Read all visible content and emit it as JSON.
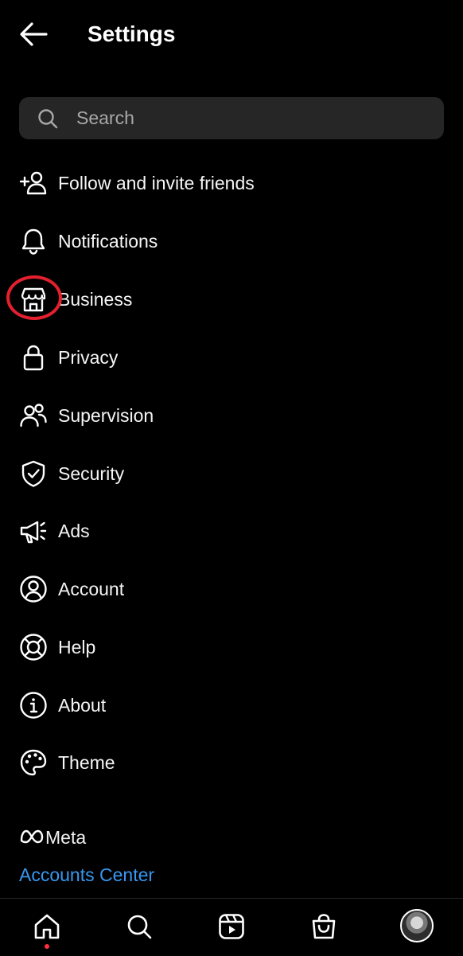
{
  "header": {
    "title": "Settings"
  },
  "search": {
    "placeholder": "Search"
  },
  "menu": [
    {
      "label": "Follow and invite friends",
      "icon": "add-person-icon"
    },
    {
      "label": "Notifications",
      "icon": "bell-icon"
    },
    {
      "label": "Business",
      "icon": "storefront-icon"
    },
    {
      "label": "Privacy",
      "icon": "lock-icon"
    },
    {
      "label": "Supervision",
      "icon": "people-icon"
    },
    {
      "label": "Security",
      "icon": "shield-check-icon"
    },
    {
      "label": "Ads",
      "icon": "megaphone-icon"
    },
    {
      "label": "Account",
      "icon": "account-circle-icon"
    },
    {
      "label": "Help",
      "icon": "lifebuoy-icon"
    },
    {
      "label": "About",
      "icon": "info-icon"
    },
    {
      "label": "Theme",
      "icon": "palette-icon"
    }
  ],
  "footer": {
    "meta_label": "Meta",
    "accounts_center": "Accounts Center"
  },
  "colors": {
    "background": "#000000",
    "accent": "#3797f0",
    "highlight": "#e5202e",
    "search_bg": "#262626"
  },
  "tabs": [
    "home-icon",
    "search-icon",
    "reels-icon",
    "shop-icon",
    "profile-avatar"
  ]
}
